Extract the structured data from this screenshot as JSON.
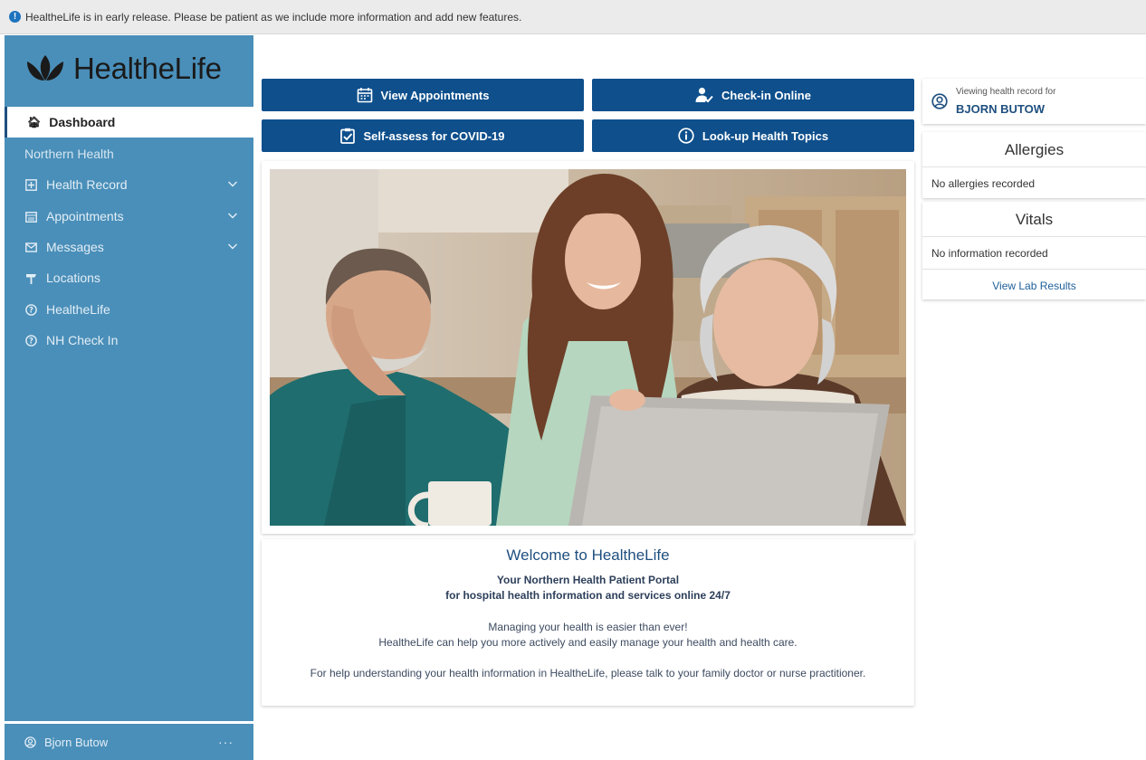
{
  "banner": {
    "text": "HealtheLife is in early release.  Please be patient as we include more information and add new features."
  },
  "sidebar": {
    "logo_text": "HealtheLife",
    "active_item": "Dashboard",
    "section_label": "Northern Health",
    "items": [
      {
        "label": "Health Record",
        "icon": "health-record-icon",
        "expandable": true
      },
      {
        "label": "Appointments",
        "icon": "appointments-icon",
        "expandable": true
      },
      {
        "label": "Messages",
        "icon": "messages-icon",
        "expandable": true
      },
      {
        "label": "Locations",
        "icon": "location-sign-icon",
        "expandable": false
      },
      {
        "label": "HealtheLife",
        "icon": "help-icon",
        "expandable": false
      },
      {
        "label": "NH Check In",
        "icon": "help-icon",
        "expandable": false
      }
    ],
    "user_name": "Bjorn Butow",
    "user_menu": "···"
  },
  "actions": {
    "view_appointments": "View Appointments",
    "check_in_online": "Check-in Online",
    "self_assess": "Self-assess for COVID-19",
    "lookup_topics": "Look-up Health Topics"
  },
  "welcome": {
    "title": "Welcome to HealtheLife",
    "subtitle_1": "Your Northern Health Patient Portal",
    "subtitle_2": "for hospital health information and services online 24/7",
    "line_1": "Managing your health is easier than ever!",
    "line_2": "HealtheLife can help you more actively and easily manage your health and health care.",
    "line_3": "For help understanding your health information in HealtheLife, please talk to your family doctor or nurse practitioner."
  },
  "record": {
    "label": "Viewing health record for",
    "patient": "BJORN BUTOW"
  },
  "allergies": {
    "title": "Allergies",
    "value": "No allergies recorded"
  },
  "vitals": {
    "title": "Vitals",
    "value": "No information recorded",
    "link": "View Lab Results"
  },
  "colors": {
    "sidebar": "#4a8fb9",
    "primary_button": "#0e4f8c",
    "link": "#1e5f99",
    "banner": "#ebebeb"
  }
}
